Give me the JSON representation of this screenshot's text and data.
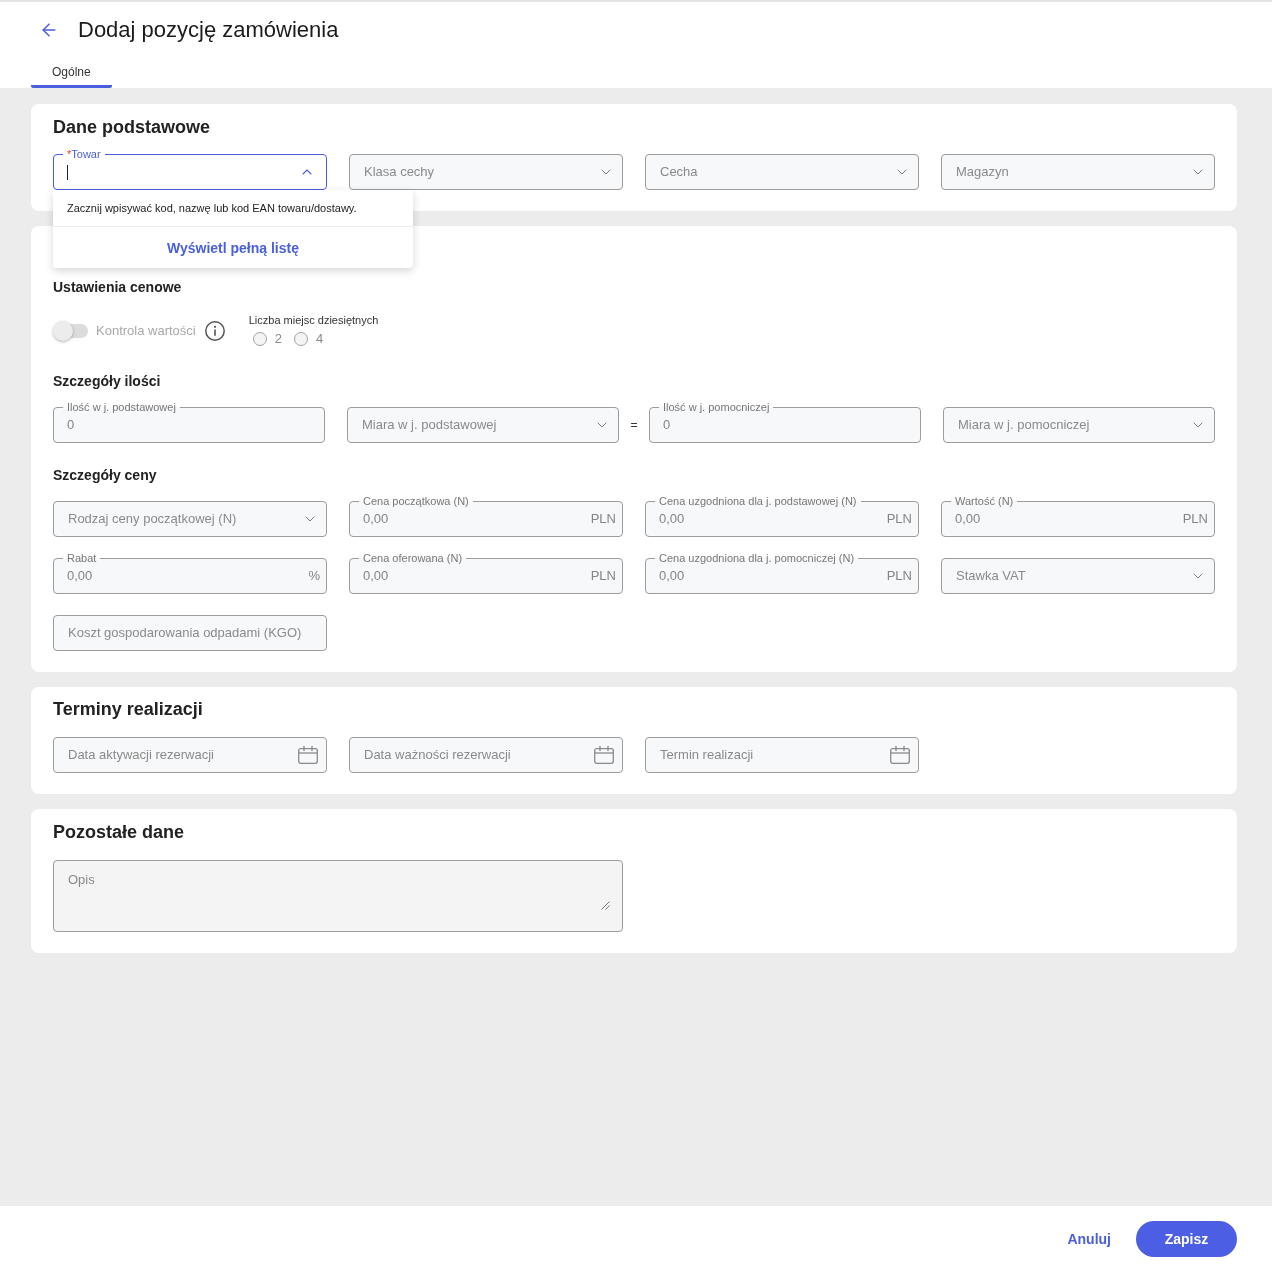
{
  "header": {
    "title": "Dodaj pozycję zamówienia"
  },
  "tabs": [
    {
      "label": "Ogólne",
      "selected": true
    }
  ],
  "basic_data": {
    "title": "Dane podstawowe",
    "fields": [
      {
        "kind": "combobox",
        "label": "Towar",
        "required_mark": "*",
        "focused": true,
        "expanded": true,
        "dropdown": {
          "hint": "Zacznij wpisywać kod, nazwę lub kod EAN towaru/dostawy.",
          "link": "Wyświetl pełną listę"
        }
      },
      {
        "kind": "select",
        "placeholder": "Klasa cechy"
      },
      {
        "kind": "select",
        "placeholder": "Cecha"
      },
      {
        "kind": "select",
        "placeholder": "Magazyn"
      }
    ]
  },
  "item_details": {
    "price_settings": {
      "title": "Ustawienia cenowe",
      "toggle": {
        "label": "Kontrola wartości",
        "on": false,
        "disabled": true
      },
      "decimal_places": {
        "label": "Liczba miejsc dziesiętnych",
        "disabled": true,
        "options": [
          {
            "label": "2",
            "selected": false
          },
          {
            "label": "4",
            "selected": false
          }
        ]
      }
    },
    "quantity": {
      "title": "Szczegóły ilości",
      "equals": "=",
      "fields": [
        {
          "kind": "number",
          "label": "Ilość w j. podstawowej",
          "value": "0"
        },
        {
          "kind": "select",
          "placeholder": "Miara w j. podstawowej"
        },
        {
          "kind": "number",
          "label": "Ilość w j. pomocniczej",
          "value": "0"
        },
        {
          "kind": "select",
          "placeholder": "Miara w j. pomocniczej"
        }
      ]
    },
    "price": {
      "title": "Szczegóły ceny",
      "fields": [
        {
          "kind": "select",
          "placeholder": "Rodzaj ceny początkowej (N)"
        },
        {
          "kind": "number",
          "label": "Cena początkowa (N)",
          "value": "0,00",
          "suffix": "PLN"
        },
        {
          "kind": "number",
          "label": "Cena uzgodniona dla j. podstawowej (N)",
          "value": "0,00",
          "suffix": "PLN"
        },
        {
          "kind": "number",
          "label": "Wartość (N)",
          "value": "0,00",
          "suffix": "PLN"
        },
        {
          "kind": "number",
          "label": "Rabat",
          "value": "0,00",
          "suffix": "%"
        },
        {
          "kind": "number",
          "label": "Cena oferowana (N)",
          "value": "0,00",
          "suffix": "PLN"
        },
        {
          "kind": "number",
          "label": "Cena uzgodniona dla j. pomocniczej (N)",
          "value": "0,00",
          "suffix": "PLN"
        },
        {
          "kind": "select",
          "placeholder": "Stawka VAT"
        },
        {
          "kind": "text",
          "placeholder": "Koszt gospodarowania odpadami (KGO)"
        }
      ]
    }
  },
  "deadlines": {
    "title": "Terminy realizacji",
    "fields": [
      {
        "kind": "date",
        "placeholder": "Data aktywacji rezerwacji"
      },
      {
        "kind": "date",
        "placeholder": "Data ważności rezerwacji"
      },
      {
        "kind": "date",
        "placeholder": "Termin realizacji"
      }
    ]
  },
  "other": {
    "title": "Pozostałe dane",
    "fields": [
      {
        "kind": "textarea",
        "placeholder": "Opis"
      }
    ]
  },
  "footer": {
    "buttons": [
      {
        "kind": "text",
        "label": "Anuluj"
      },
      {
        "kind": "primary",
        "label": "Zapisz"
      }
    ]
  }
}
